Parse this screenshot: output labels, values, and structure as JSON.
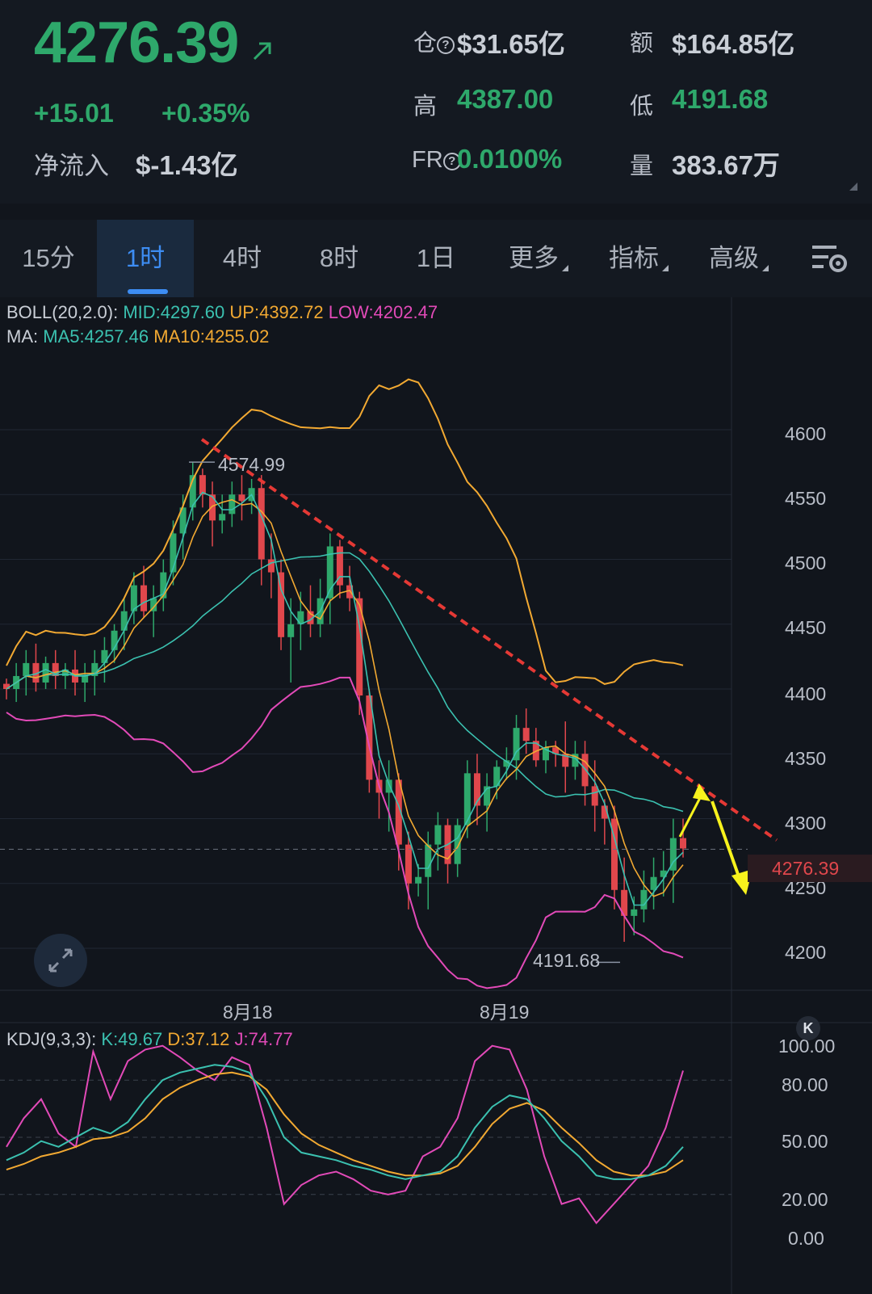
{
  "header": {
    "last_price": "4276.39",
    "change": "+15.01",
    "change_pct": "+0.35%",
    "net_inflow_label": "净流入",
    "net_inflow_value": "$-1.43亿",
    "open_interest_label": "仓",
    "open_interest_value": "$31.65亿",
    "turnover_label": "额",
    "turnover_value": "$164.85亿",
    "high_label": "高",
    "high_value": "4387.00",
    "low_label": "低",
    "low_value": "4191.68",
    "funding_rate_label": "FR",
    "funding_rate_value": "0.0100%",
    "volume_label": "量",
    "volume_value": "383.67万",
    "help_glyph": "?"
  },
  "tabs": [
    {
      "label": "15分",
      "active": false
    },
    {
      "label": "1时",
      "active": true
    },
    {
      "label": "4时",
      "active": false
    },
    {
      "label": "8时",
      "active": false
    },
    {
      "label": "1日",
      "active": false
    },
    {
      "label": "更多",
      "active": false,
      "dropdown": true
    },
    {
      "label": "指标",
      "active": false,
      "dropdown": true
    },
    {
      "label": "高级",
      "active": false,
      "dropdown": true
    }
  ],
  "indicators": {
    "boll_prefix": "BOLL(20,2.0):",
    "boll_mid": "MID:4297.60",
    "boll_up": "UP:4392.72",
    "boll_low": "LOW:4202.47",
    "ma_prefix": "MA:",
    "ma5": "MA5:4257.46",
    "ma10": "MA10:4255.02",
    "kdj_prefix": "KDJ(9,3,3):",
    "kdj_k": "K:49.67",
    "kdj_d": "D:37.12",
    "kdj_j": "J:74.77"
  },
  "price_axis": [
    "4600",
    "4550",
    "4500",
    "4450",
    "4400",
    "4350",
    "4300",
    "4250",
    "4200"
  ],
  "kdj_axis": [
    "100.00",
    "80.00",
    "50.00",
    "20.00",
    "0.00"
  ],
  "dates": [
    "8月18",
    "8月19"
  ],
  "annotations": {
    "high_marker": "4574.99",
    "low_marker": "4191.68",
    "current_price_tag": "4276.39"
  },
  "colors": {
    "up": "#2ea86b",
    "down": "#e0474c",
    "boll_mid": "#3bc1b0",
    "boll_up": "#f2a932",
    "boll_low": "#e24ab8",
    "ma5": "#3bc1b0",
    "ma10": "#f2a932",
    "accent": "#3d8df3",
    "trendline": "#e53935",
    "arrow": "#f7f21d"
  },
  "icons": {
    "price_trend": "arrow-up-right-icon",
    "chart_settings": "chart-settings-icon",
    "expand": "expand-icon",
    "scroll_latest": "k-icon"
  },
  "k_button_label": "K",
  "chart_data": {
    "type": "candlestick",
    "interval": "1h",
    "y_range": [
      4170,
      4700
    ],
    "last_price": 4276.39,
    "high": 4574.99,
    "low": 4191.68,
    "candles": [
      [
        4404,
        4408,
        4392,
        4400
      ],
      [
        4400,
        4420,
        4390,
        4410
      ],
      [
        4410,
        4430,
        4395,
        4420
      ],
      [
        4420,
        4435,
        4398,
        4405
      ],
      [
        4405,
        4425,
        4400,
        4420
      ],
      [
        4420,
        4430,
        4400,
        4410
      ],
      [
        4410,
        4420,
        4400,
        4415
      ],
      [
        4415,
        4430,
        4395,
        4405
      ],
      [
        4405,
        4420,
        4390,
        4410
      ],
      [
        4410,
        4430,
        4395,
        4420
      ],
      [
        4420,
        4440,
        4405,
        4430
      ],
      [
        4430,
        4450,
        4420,
        4445
      ],
      [
        4445,
        4470,
        4430,
        4460
      ],
      [
        4460,
        4490,
        4450,
        4480
      ],
      [
        4480,
        4495,
        4455,
        4460
      ],
      [
        4460,
        4480,
        4440,
        4470
      ],
      [
        4470,
        4500,
        4460,
        4490
      ],
      [
        4490,
        4530,
        4480,
        4520
      ],
      [
        4520,
        4550,
        4500,
        4540
      ],
      [
        4540,
        4575,
        4530,
        4565
      ],
      [
        4565,
        4570,
        4540,
        4550
      ],
      [
        4550,
        4560,
        4510,
        4530
      ],
      [
        4530,
        4550,
        4520,
        4535
      ],
      [
        4535,
        4560,
        4525,
        4550
      ],
      [
        4550,
        4565,
        4530,
        4545
      ],
      [
        4545,
        4562,
        4535,
        4555
      ],
      [
        4555,
        4565,
        4480,
        4500
      ],
      [
        4500,
        4520,
        4470,
        4490
      ],
      [
        4490,
        4500,
        4430,
        4440
      ],
      [
        4440,
        4470,
        4405,
        4450
      ],
      [
        4450,
        4475,
        4430,
        4460
      ],
      [
        4460,
        4480,
        4440,
        4450
      ],
      [
        4450,
        4485,
        4440,
        4470
      ],
      [
        4470,
        4520,
        4450,
        4510
      ],
      [
        4510,
        4515,
        4470,
        4480
      ],
      [
        4480,
        4495,
        4460,
        4470
      ],
      [
        4470,
        4475,
        4380,
        4395
      ],
      [
        4395,
        4400,
        4320,
        4330
      ],
      [
        4330,
        4345,
        4300,
        4320
      ],
      [
        4320,
        4345,
        4290,
        4330
      ],
      [
        4330,
        4335,
        4260,
        4280
      ],
      [
        4280,
        4290,
        4230,
        4250
      ],
      [
        4250,
        4265,
        4240,
        4255
      ],
      [
        4255,
        4290,
        4230,
        4280
      ],
      [
        4280,
        4305,
        4260,
        4295
      ],
      [
        4295,
        4300,
        4250,
        4265
      ],
      [
        4265,
        4300,
        4255,
        4295
      ],
      [
        4295,
        4345,
        4285,
        4335
      ],
      [
        4335,
        4350,
        4295,
        4310
      ],
      [
        4310,
        4335,
        4290,
        4325
      ],
      [
        4325,
        4345,
        4315,
        4340
      ],
      [
        4340,
        4355,
        4330,
        4345
      ],
      [
        4345,
        4380,
        4330,
        4370
      ],
      [
        4370,
        4385,
        4350,
        4360
      ],
      [
        4360,
        4370,
        4340,
        4345
      ],
      [
        4345,
        4360,
        4335,
        4355
      ],
      [
        4355,
        4360,
        4340,
        4350
      ],
      [
        4350,
        4375,
        4320,
        4340
      ],
      [
        4340,
        4360,
        4330,
        4350
      ],
      [
        4350,
        4360,
        4310,
        4325
      ],
      [
        4325,
        4345,
        4290,
        4310
      ],
      [
        4310,
        4315,
        4280,
        4300
      ],
      [
        4300,
        4310,
        4230,
        4245
      ],
      [
        4245,
        4270,
        4205,
        4225
      ],
      [
        4225,
        4240,
        4210,
        4230
      ],
      [
        4230,
        4260,
        4220,
        4245
      ],
      [
        4245,
        4270,
        4230,
        4255
      ],
      [
        4255,
        4275,
        4240,
        4260
      ],
      [
        4260,
        4300,
        4235,
        4285
      ],
      [
        4285,
        4300,
        4270,
        4277
      ]
    ],
    "kdj": {
      "k": [
        38,
        42,
        48,
        45,
        50,
        55,
        52,
        58,
        70,
        80,
        84,
        86,
        88,
        87,
        84,
        70,
        50,
        42,
        40,
        38,
        35,
        33,
        30,
        28,
        30,
        32,
        40,
        55,
        66,
        72,
        70,
        60,
        48,
        40,
        30,
        28,
        28,
        30,
        35,
        45
      ],
      "d": [
        33,
        36,
        40,
        42,
        45,
        49,
        50,
        53,
        60,
        70,
        76,
        80,
        83,
        84,
        82,
        75,
        62,
        52,
        46,
        42,
        38,
        35,
        32,
        30,
        30,
        31,
        35,
        45,
        57,
        65,
        68,
        64,
        55,
        47,
        38,
        32,
        30,
        30,
        32,
        38
      ],
      "j": [
        45,
        60,
        70,
        52,
        45,
        95,
        70,
        90,
        96,
        98,
        92,
        85,
        80,
        92,
        88,
        55,
        15,
        25,
        30,
        32,
        28,
        22,
        20,
        22,
        40,
        45,
        60,
        90,
        98,
        96,
        75,
        40,
        15,
        18,
        5,
        15,
        25,
        35,
        55,
        85
      ]
    }
  }
}
